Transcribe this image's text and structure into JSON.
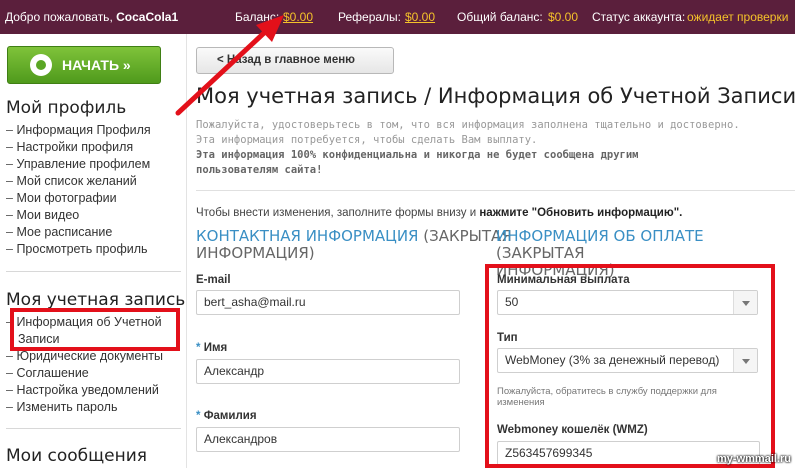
{
  "topbar": {
    "welcome": "Добро пожаловать,",
    "username": "CocaCola1",
    "balance_label": "Баланс:",
    "balance_value": "$0.00",
    "referrals_label": "Рефералы:",
    "referrals_value": "$0.00",
    "total_label": "Общий баланс:",
    "total_value": "$0.00",
    "status_label": "Статус аккаунта:",
    "status_value": "ожидает проверки"
  },
  "sidebar": {
    "start_button": "НАЧАТЬ »",
    "profile_heading": "Мой профиль",
    "profile_items": [
      "Информация Профиля",
      "Настройки профиля",
      "Управление профилем",
      "Мой список желаний",
      "Мои фотографии",
      "Мои видео",
      "Мое расписание",
      "Просмотреть профиль"
    ],
    "account_heading": "Моя учетная запись",
    "account_items": [
      "Информация об Учетной",
      "Записи",
      "Юридические документы",
      "Соглашение",
      "Настройка уведомлений",
      "Изменить пароль"
    ],
    "messages_heading": "Мои сообщения"
  },
  "main": {
    "back_button": "< Назад в главное меню",
    "title": "Моя учетная запись / Информация об Учетной Записи",
    "intro_line1": "Пожалуйста, удостоверьтесь в том, что вся информация заполнена тщательно и достоверно.",
    "intro_line2": "Эта информация потребуется, чтобы сделать Вам выплату.",
    "intro_bold1": "Эта информация 100% конфиденциальна и никогда не будет сообщена другим",
    "intro_bold2": "пользователям сайта!",
    "hint_text": "Чтобы внести изменения, заполните формы внизу и",
    "hint_bold": "нажмите \"Обновить информацию\".",
    "contact": {
      "heading_blue": "КОНТАКТНАЯ ИНФОРМАЦИЯ",
      "heading_rest1": " (ЗАКРЫТАЯ",
      "heading_rest2": "ИНФОРМАЦИЯ)",
      "email_label": "E-mail",
      "email_value": "bert_asha@mail.ru",
      "name_label": "Имя",
      "name_value": "Александр",
      "surname_label": "Фамилия",
      "surname_value": "Александров"
    },
    "payment": {
      "heading_blue": "ИНФОРМАЦИЯ ОБ ОПЛАТЕ",
      "heading_rest1": " (ЗАКРЫТАЯ",
      "heading_rest2": "ИНФОРМАЦИЯ)",
      "min_label": "Минимальная выплата",
      "min_value": "50",
      "type_label": "Тип",
      "type_value": "WebMoney (3% за денежный перевод)",
      "type_note1": "Пожалуйста, обратитесь в службу поддержки для",
      "type_note2": "изменения",
      "wallet_label": "Webmoney кошелёк (WMZ)",
      "wallet_value": "Z563457699345"
    },
    "required_mark": "*"
  },
  "watermark": "my-wmmail.ru",
  "colors": {
    "topbar_bg": "#5b1f3c",
    "money": "#f4c22a",
    "accent_blue": "#3a8fc4",
    "annotation_red": "#e3101a",
    "start_green": "#5aa624"
  }
}
